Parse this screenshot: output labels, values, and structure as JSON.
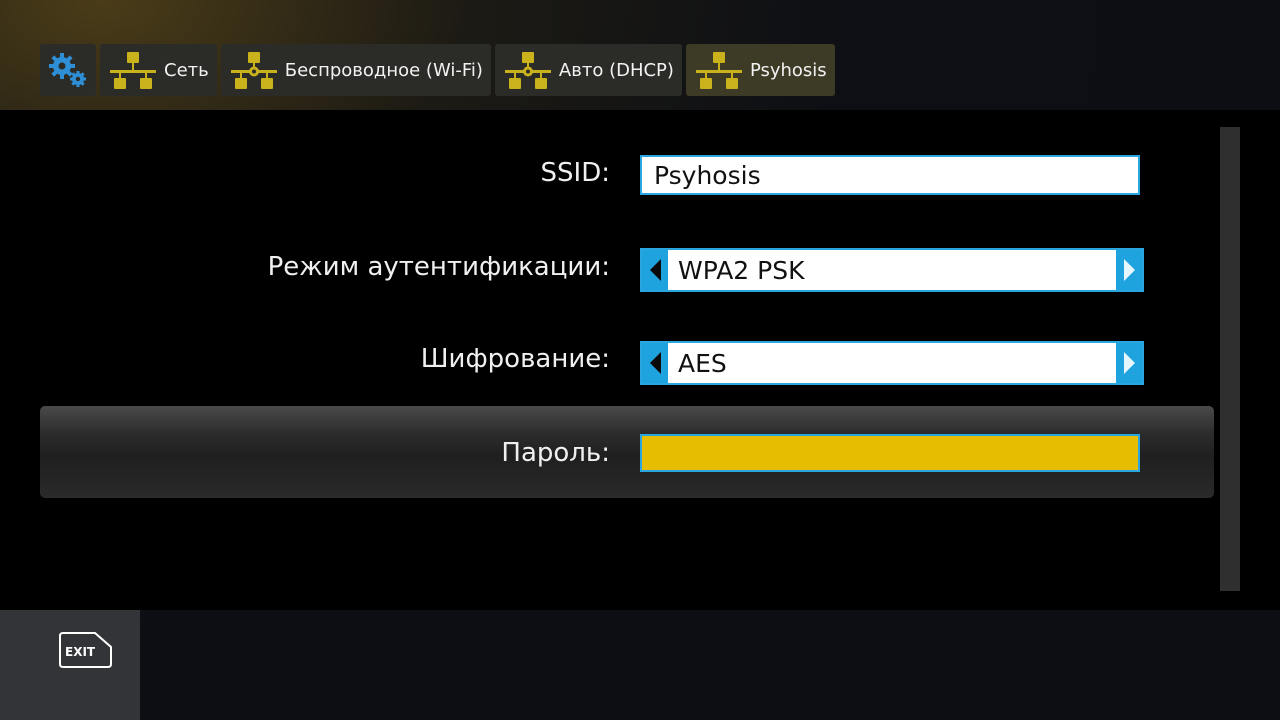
{
  "breadcrumb": {
    "items": [
      {
        "label": "Сеть"
      },
      {
        "label": "Беспроводное (Wi-Fi)"
      },
      {
        "label": "Авто (DHCP)"
      },
      {
        "label": "Psyhosis"
      }
    ],
    "icons": {
      "settings": "gears-icon",
      "network": "network-icon",
      "network_config": "network-gear-icon"
    }
  },
  "form": {
    "ssid": {
      "label": "SSID:",
      "value": "Psyhosis"
    },
    "auth_mode": {
      "label": "Режим аутентификации:",
      "value": "WPA2 PSK"
    },
    "encryption": {
      "label": "Шифрование:",
      "value": "AES"
    },
    "password": {
      "label": "Пароль:",
      "value": ""
    }
  },
  "footer": {
    "exit_label": "EXIT"
  },
  "colors": {
    "accent_blue": "#29a6e0",
    "highlight_yellow": "#e6bd00",
    "icon_yellow": "#c9b21c"
  }
}
